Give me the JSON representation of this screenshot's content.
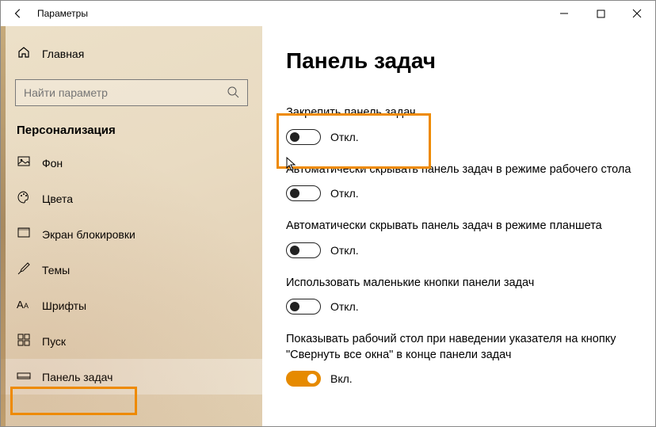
{
  "titlebar": {
    "title": "Параметры"
  },
  "sidebar": {
    "home": "Главная",
    "search_placeholder": "Найти параметр",
    "section": "Персонализация",
    "items": [
      {
        "label": "Фон"
      },
      {
        "label": "Цвета"
      },
      {
        "label": "Экран блокировки"
      },
      {
        "label": "Темы"
      },
      {
        "label": "Шрифты"
      },
      {
        "label": "Пуск"
      },
      {
        "label": "Панель задач"
      }
    ]
  },
  "content": {
    "heading": "Панель задач",
    "settings": [
      {
        "label": "Закрепить панель задач",
        "state": "Откл.",
        "on": false
      },
      {
        "label": "Автоматически скрывать панель задач в режиме рабочего стола",
        "state": "Откл.",
        "on": false
      },
      {
        "label": "Автоматически скрывать панель задач в режиме планшета",
        "state": "Откл.",
        "on": false
      },
      {
        "label": "Использовать маленькие кнопки панели задач",
        "state": "Откл.",
        "on": false
      },
      {
        "label": "Показывать рабочий стол при наведении указателя на кнопку \"Свернуть все окна\" в конце панели задач",
        "state": "Вкл.",
        "on": true
      }
    ]
  }
}
